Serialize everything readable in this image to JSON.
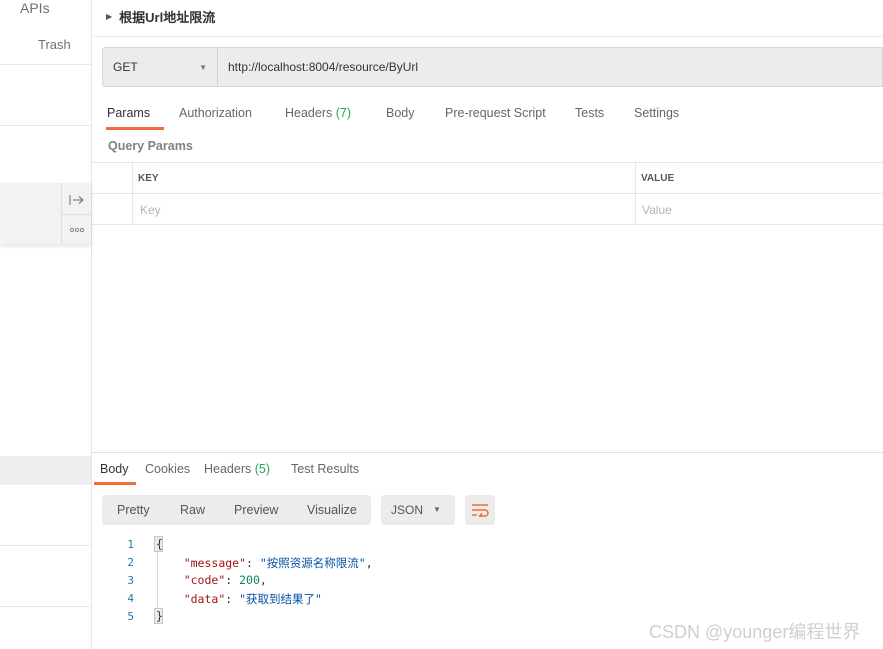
{
  "sidebar": {
    "apis_label": "APIs",
    "trash_label": "Trash",
    "action_collapse_icon": "arrow-to-line-icon",
    "action_more_icon": "more-icon"
  },
  "request": {
    "title": "根据Url地址限流",
    "method": "GET",
    "url": "http://localhost:8004/resource/ByUrl"
  },
  "request_tabs": [
    {
      "label": "Params",
      "active": true
    },
    {
      "label": "Authorization"
    },
    {
      "label": "Headers",
      "count": "(7)"
    },
    {
      "label": "Body"
    },
    {
      "label": "Pre-request Script"
    },
    {
      "label": "Tests"
    },
    {
      "label": "Settings"
    }
  ],
  "query_params": {
    "title": "Query Params",
    "columns": [
      "KEY",
      "VALUE"
    ],
    "placeholders": {
      "key": "Key",
      "value": "Value"
    }
  },
  "response_tabs": [
    {
      "label": "Body",
      "active": true
    },
    {
      "label": "Cookies"
    },
    {
      "label": "Headers",
      "count": "(5)"
    },
    {
      "label": "Test Results"
    }
  ],
  "format_options": [
    "Pretty",
    "Raw",
    "Preview",
    "Visualize"
  ],
  "language": "JSON",
  "response_body": {
    "line_numbers": [
      "1",
      "2",
      "3",
      "4",
      "5"
    ],
    "open_brace": "{",
    "close_brace": "}",
    "message_key": "\"message\"",
    "message_value": "\"按照资源名称限流\"",
    "code_key": "\"code\"",
    "code_value": "200",
    "data_key": "\"data\"",
    "data_value": "\"获取到结果了\""
  },
  "watermark": "CSDN @younger编程世界",
  "colors": {
    "accent": "#f26b3a",
    "count_green": "#26a65b"
  }
}
